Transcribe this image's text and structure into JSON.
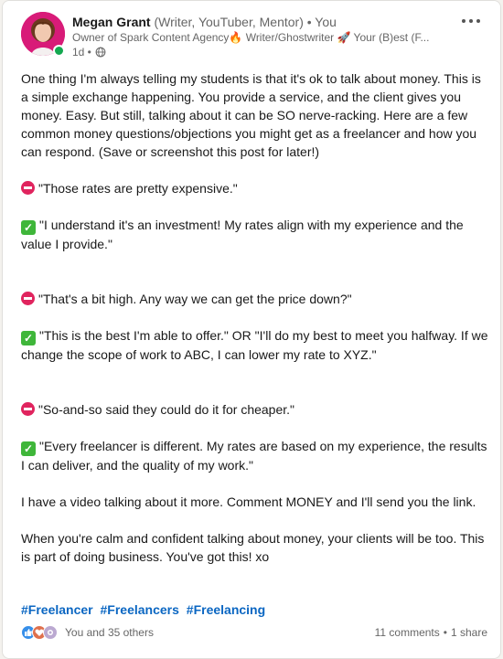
{
  "author": {
    "name": "Megan Grant",
    "tags": "(Writer, YouTuber, Mentor)",
    "relation": "• You",
    "headline": "Owner of Spark Content Agency🔥 Writer/Ghostwriter 🚀 Your (B)est (F...",
    "time": "1d •"
  },
  "post": {
    "intro": "One thing I'm always telling my students is that it's ok to talk about money. This is a simple exchange happening. You provide a service, and the client gives you money. Easy. But still, talking about it can be SO nerve-racking. Here are a few common money questions/objections you might get as a freelancer and how you can respond. (Save or screenshot this post for later!)",
    "objection1": "\"Those rates are pretty expensive.\"",
    "answer1": "\"I understand it's an investment! My rates align with my experience and the value I provide.\"",
    "objection2": "\"That's a bit high. Any way we can get the price down?\"",
    "answer2": "\"This is the best I'm able to offer.\" OR \"I'll do my best to meet you halfway. If we change the scope of work to ABC, I can lower my rate to XYZ.\"",
    "objection3": "\"So-and-so said they could do it for cheaper.\"",
    "answer3": "\"Every freelancer is different. My rates are based on my experience, the results I can deliver, and the quality of my work.\"",
    "video_note": "I have a video talking about it more. Comment MONEY and I'll send you the link.",
    "closing": "When you're calm and confident talking about money, your clients will be too. This is part of doing business. You've got this! xo",
    "hashtags": [
      "#Freelancer",
      "#Freelancers",
      "#Freelancing"
    ]
  },
  "social": {
    "reactions": "You and 35 others",
    "comments": "11 comments",
    "separator": "•",
    "shares": "1 share"
  },
  "colors": {
    "link": "#0a66c2",
    "online": "#14a850",
    "avatar_bg": "#d81b78"
  },
  "icons": [
    "more-options-icon",
    "globe-icon",
    "no-entry-icon",
    "check-mark-icon",
    "like-reaction-icon",
    "love-reaction-icon",
    "support-reaction-icon"
  ]
}
